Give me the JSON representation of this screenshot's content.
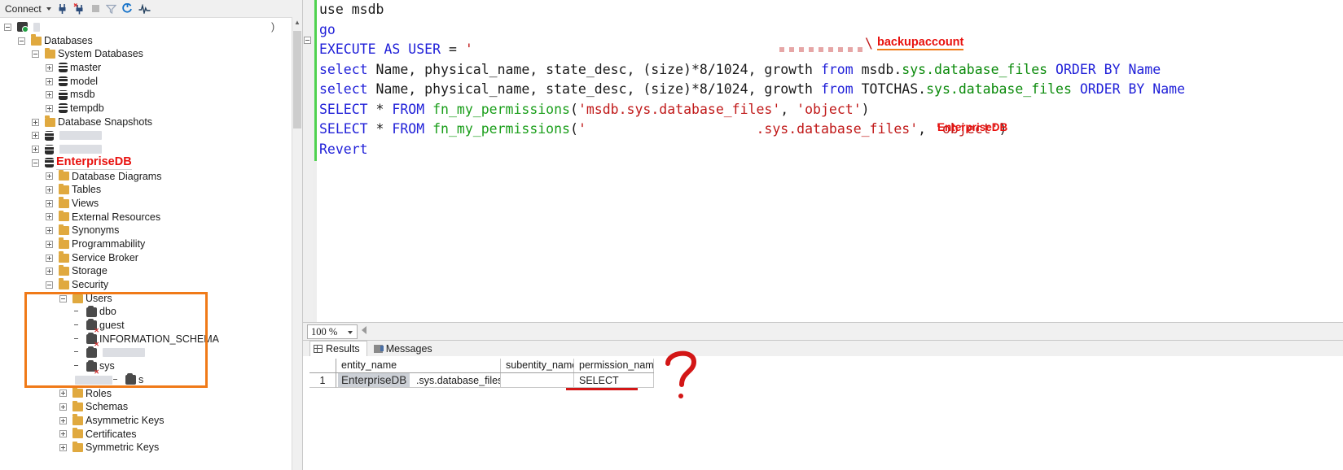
{
  "explorer": {
    "toolbar": {
      "connect_label": "Connect",
      "icons": [
        "connect-icon",
        "disconnect-icon",
        "stop-icon",
        "filter-icon",
        "refresh-icon",
        "activity-monitor-icon"
      ]
    },
    "tree": [
      {
        "label": "",
        "indent": 0,
        "state": "minus",
        "icon": "server-icon",
        "redacted": true,
        "redact_width": 0
      },
      {
        "label": "Databases",
        "indent": 1,
        "state": "minus",
        "icon": "folder-icon"
      },
      {
        "label": "System Databases",
        "indent": 2,
        "state": "minus",
        "icon": "folder-icon"
      },
      {
        "label": "master",
        "indent": 3,
        "state": "plus",
        "icon": "database-icon"
      },
      {
        "label": "model",
        "indent": 3,
        "state": "plus",
        "icon": "database-icon"
      },
      {
        "label": "msdb",
        "indent": 3,
        "state": "plus",
        "icon": "database-icon"
      },
      {
        "label": "tempdb",
        "indent": 3,
        "state": "plus",
        "icon": "database-icon"
      },
      {
        "label": "Database Snapshots",
        "indent": 2,
        "state": "plus",
        "icon": "folder-icon"
      },
      {
        "label": "",
        "indent": 2,
        "state": "plus",
        "icon": "database-icon",
        "redacted": true
      },
      {
        "label": "",
        "indent": 2,
        "state": "plus",
        "icon": "database-icon",
        "redacted": true
      },
      {
        "label": "EnterpriseDB",
        "indent": 2,
        "state": "minus",
        "icon": "database-icon",
        "style": "red-annotation"
      },
      {
        "label": "Database Diagrams",
        "indent": 3,
        "state": "plus",
        "icon": "folder-icon"
      },
      {
        "label": "Tables",
        "indent": 3,
        "state": "plus",
        "icon": "folder-icon"
      },
      {
        "label": "Views",
        "indent": 3,
        "state": "plus",
        "icon": "folder-icon"
      },
      {
        "label": "External Resources",
        "indent": 3,
        "state": "plus",
        "icon": "folder-icon"
      },
      {
        "label": "Synonyms",
        "indent": 3,
        "state": "plus",
        "icon": "folder-icon"
      },
      {
        "label": "Programmability",
        "indent": 3,
        "state": "plus",
        "icon": "folder-icon"
      },
      {
        "label": "Service Broker",
        "indent": 3,
        "state": "plus",
        "icon": "folder-icon"
      },
      {
        "label": "Storage",
        "indent": 3,
        "state": "plus",
        "icon": "folder-icon"
      },
      {
        "label": "Security",
        "indent": 3,
        "state": "minus",
        "icon": "folder-icon"
      },
      {
        "label": "Users",
        "indent": 4,
        "state": "minus",
        "icon": "folder-icon"
      },
      {
        "label": "dbo",
        "indent": 5,
        "state": "none",
        "icon": "user-icon"
      },
      {
        "label": "guest",
        "indent": 5,
        "state": "none",
        "icon": "user-disabled-icon"
      },
      {
        "label": "INFORMATION_SCHEMA",
        "indent": 5,
        "state": "none",
        "icon": "user-disabled-icon"
      },
      {
        "label": "",
        "indent": 5,
        "state": "none",
        "icon": "user-icon",
        "redacted": true
      },
      {
        "label": "sys",
        "indent": 5,
        "state": "none",
        "icon": "user-disabled-icon"
      },
      {
        "label": "s",
        "indent": 5,
        "state": "none",
        "icon": "user-icon",
        "partially_redacted": true
      },
      {
        "label": "Roles",
        "indent": 4,
        "state": "plus",
        "icon": "folder-icon"
      },
      {
        "label": "Schemas",
        "indent": 4,
        "state": "plus",
        "icon": "folder-icon"
      },
      {
        "label": "Asymmetric Keys",
        "indent": 4,
        "state": "plus",
        "icon": "folder-icon"
      },
      {
        "label": "Certificates",
        "indent": 4,
        "state": "plus",
        "icon": "folder-icon"
      },
      {
        "label": "Symmetric Keys",
        "indent": 4,
        "state": "plus",
        "icon": "folder-icon"
      }
    ],
    "highlight_box_name": "users-highlight-box"
  },
  "editor": {
    "lines": [
      {
        "n": 1,
        "tokens": [
          {
            "t": "use ",
            "c": "blk"
          },
          {
            "t": "msdb",
            "c": "blk"
          }
        ]
      },
      {
        "n": 2,
        "tokens": [
          {
            "t": "go",
            "c": "kw"
          }
        ]
      },
      {
        "n": 3,
        "tokens": [
          {
            "t": "EXECUTE AS USER",
            "c": "kw"
          },
          {
            "t": " = ",
            "c": "blk"
          },
          {
            "t": "'",
            "c": "str"
          }
        ]
      },
      {
        "n": 4,
        "tokens": [
          {
            "t": "select ",
            "c": "kw"
          },
          {
            "t": "Name",
            "c": "blk"
          },
          {
            "t": ", physical_name, state_desc, (size)*8/1024, growth ",
            "c": "blk"
          },
          {
            "t": "from ",
            "c": "kw"
          },
          {
            "t": "msdb",
            "c": "blk"
          },
          {
            "t": ".",
            "c": "blk"
          },
          {
            "t": "sys.database_files",
            "c": "grn"
          },
          {
            "t": " ",
            "c": "blk"
          },
          {
            "t": "ORDER BY",
            "c": "kw"
          },
          {
            "t": " ",
            "c": "blk"
          },
          {
            "t": "Name",
            "c": "kw"
          }
        ]
      },
      {
        "n": 5,
        "tokens": [
          {
            "t": "select ",
            "c": "kw"
          },
          {
            "t": "Name",
            "c": "blk"
          },
          {
            "t": ", physical_name, state_desc, (size)*8/1024, growth ",
            "c": "blk"
          },
          {
            "t": "from ",
            "c": "kw"
          },
          {
            "t": "TOTCHAS",
            "c": "blk"
          },
          {
            "t": ".",
            "c": "blk"
          },
          {
            "t": "sys.database_files",
            "c": "grn"
          },
          {
            "t": " ",
            "c": "blk"
          },
          {
            "t": "ORDER BY",
            "c": "kw"
          },
          {
            "t": " ",
            "c": "blk"
          },
          {
            "t": "Name",
            "c": "kw"
          }
        ]
      },
      {
        "n": 6,
        "tokens": [
          {
            "t": "SELECT",
            "c": "kw"
          },
          {
            "t": " * ",
            "c": "blk"
          },
          {
            "t": "FROM",
            "c": "kw"
          },
          {
            "t": " ",
            "c": "blk"
          },
          {
            "t": "fn_my_permissions",
            "c": "fn"
          },
          {
            "t": "(",
            "c": "blk"
          },
          {
            "t": "'msdb.sys.database_files'",
            "c": "str"
          },
          {
            "t": ", ",
            "c": "blk"
          },
          {
            "t": "'object'",
            "c": "str"
          },
          {
            "t": ")",
            "c": "blk"
          }
        ]
      },
      {
        "n": 7,
        "tokens": [
          {
            "t": "SELECT",
            "c": "kw"
          },
          {
            "t": " * ",
            "c": "blk"
          },
          {
            "t": "FROM",
            "c": "kw"
          },
          {
            "t": " ",
            "c": "blk"
          },
          {
            "t": "fn_my_permissions",
            "c": "fn"
          },
          {
            "t": "(",
            "c": "blk"
          },
          {
            "t": "'                     .sys.database_files'",
            "c": "str"
          },
          {
            "t": ", ",
            "c": "blk"
          },
          {
            "t": "'object'",
            "c": "str"
          },
          {
            "t": ")",
            "c": "blk"
          }
        ]
      },
      {
        "n": 8,
        "tokens": [
          {
            "t": "Revert",
            "c": "kw"
          }
        ]
      }
    ],
    "annotations": {
      "backupaccount": "backupaccount",
      "enterprisedb_inline": "EnterpriseDB",
      "path_separator": "\\"
    }
  },
  "zoom_bar": {
    "zoom_level": "100 %"
  },
  "results": {
    "tabs": [
      {
        "label": "Results",
        "icon": "grid-icon",
        "active": true
      },
      {
        "label": "Messages",
        "icon": "messages-icon",
        "active": false
      }
    ],
    "columns": [
      "",
      "entity_name",
      "subentity_name",
      "permission_name"
    ],
    "rows": [
      {
        "num": "1",
        "entity_name": ".sys.database_files",
        "subentity_name": "",
        "permission_name": "SELECT"
      }
    ],
    "overlay_entity_label": "EnterpriseDB",
    "annotation_question_mark": "?"
  },
  "colors": {
    "annotation_red": "#e8110e",
    "annotation_orange": "#f07a18",
    "sql_keyword": "#1f1fd8",
    "sql_string": "#c01818",
    "sql_schema": "#0a8a0a",
    "sql_function": "#1a9e1a"
  }
}
